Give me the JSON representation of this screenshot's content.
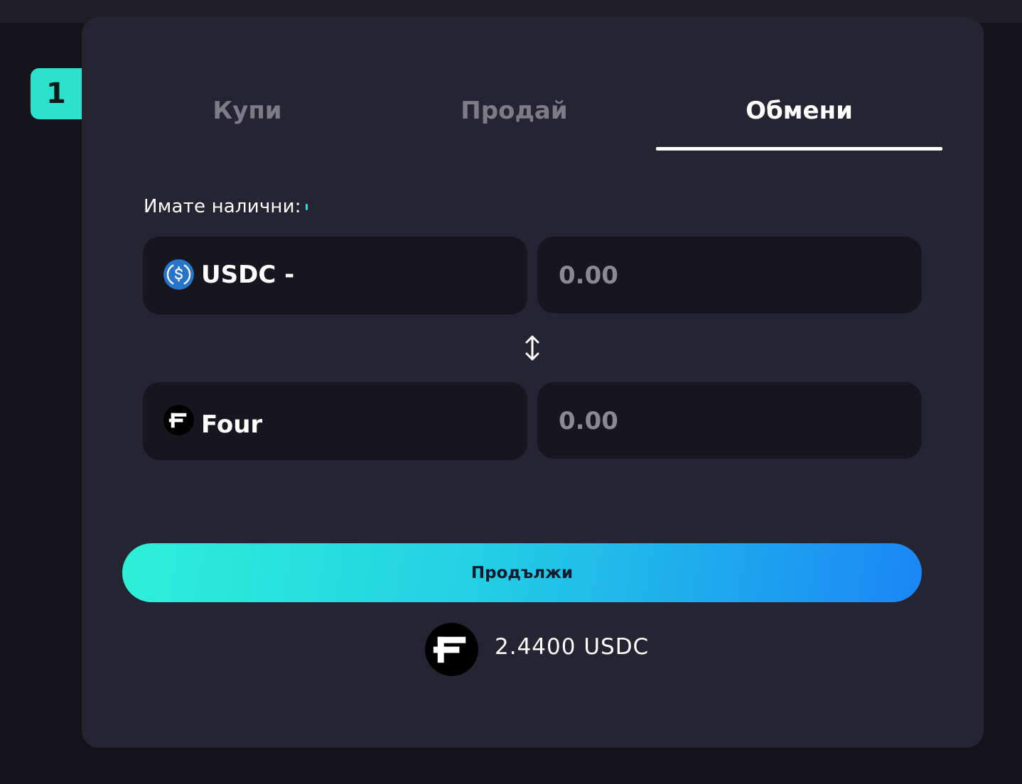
{
  "step": {
    "number": "1"
  },
  "tabs": [
    {
      "label": "Купи",
      "active": false
    },
    {
      "label": "Продай",
      "active": false
    },
    {
      "label": "Обмени",
      "active": true
    }
  ],
  "balance": {
    "label": "Имате налични:"
  },
  "from": {
    "token_label": "USDC -",
    "icon": "usdc-icon",
    "amount_placeholder": "0.00"
  },
  "swap": {
    "icon": "swap-vertical-icon"
  },
  "to": {
    "token_label": "Four",
    "icon": "four-token-icon",
    "amount_placeholder": "0.00"
  },
  "actions": {
    "continue_label": "Продължи"
  },
  "rate": {
    "text": "2.4400 USDC",
    "icon": "four-token-icon"
  },
  "colors": {
    "accent_start": "#2ef0d8",
    "accent_end": "#1a86f5",
    "card_bg": "#252432",
    "field_bg": "#17161f",
    "page_bg": "#141319",
    "usdc_blue": "#2775ca"
  }
}
